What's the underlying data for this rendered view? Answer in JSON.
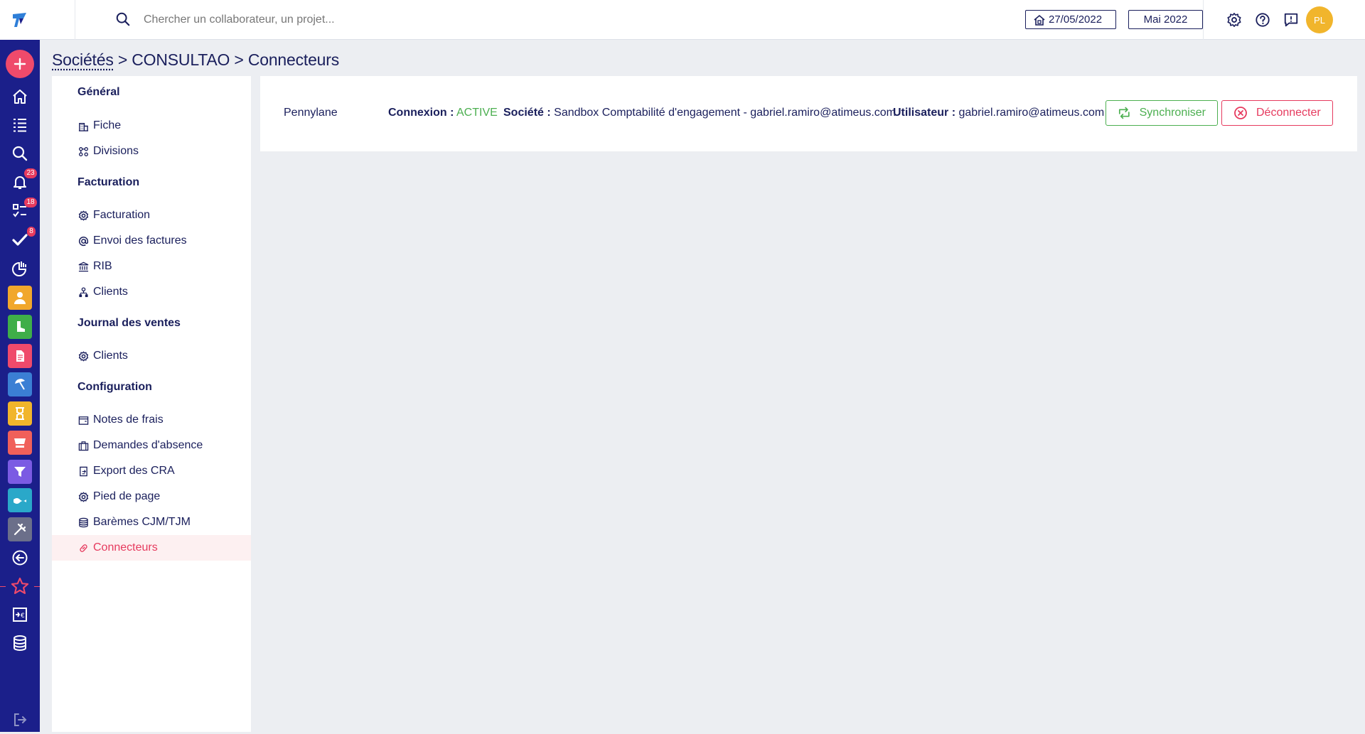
{
  "header": {
    "search_placeholder": "Chercher un collaborateur, un projet...",
    "date": "27/05/2022",
    "month": "Mai 2022",
    "avatar_initials": "PL"
  },
  "rail": {
    "badges": {
      "notifications": "23",
      "tasks": "18",
      "validations": "8"
    },
    "colors": {
      "background": "#1b1f8a",
      "add": "#ef4a6b",
      "person": "#f1a72c",
      "green": "#3fae49",
      "document": "#ef4a6b",
      "blue": "#3b7fd4",
      "yellow": "#f1b52c",
      "cart": "#f0605a",
      "filter": "#7b5be3",
      "wave": "#2aa8c9",
      "tools": "#6b6f8a"
    }
  },
  "breadcrumb": {
    "link": "Sociétés",
    "sep1": ">",
    "company": "CONSULTAO",
    "sep2": ">",
    "current": "Connecteurs"
  },
  "nav": {
    "sections": {
      "general": "Général",
      "facturation": "Facturation",
      "journal": "Journal des ventes",
      "configuration": "Configuration"
    },
    "items": {
      "fiche": "Fiche",
      "divisions": "Divisions",
      "facturation": "Facturation",
      "envoi_factures": "Envoi des factures",
      "rib": "RIB",
      "clients": "Clients",
      "journal_clients": "Clients",
      "notes_frais": "Notes de frais",
      "demandes_absence": "Demandes d'absence",
      "export_cra": "Export des CRA",
      "pied_page": "Pied de page",
      "baremes": "Barèmes CJM/TJM",
      "connecteurs": "Connecteurs"
    }
  },
  "connector": {
    "name": "Pennylane",
    "connexion_label": "Connexion :",
    "connexion_status": "ACTIVE",
    "societe_label": "Société :",
    "societe_value": "Sandbox Comptabilité d'engagement - gabriel.ramiro@atimeus.com",
    "utilisateur_label": "Utilisateur :",
    "utilisateur_value": "gabriel.ramiro@atimeus.com",
    "sync_label": "Synchroniser",
    "disconnect_label": "Déconnecter",
    "colors": {
      "active": "#4caf50",
      "danger": "#e63a5e"
    }
  }
}
